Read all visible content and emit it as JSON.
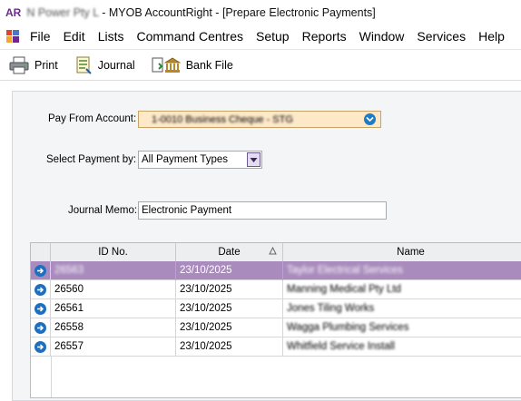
{
  "window": {
    "app_logo": "AR",
    "title_prefix": "N Power Pty L",
    "title": " - MYOB AccountRight - [Prepare Electronic Payments]"
  },
  "menu": {
    "items": [
      "File",
      "Edit",
      "Lists",
      "Command Centres",
      "Setup",
      "Reports",
      "Window",
      "Services",
      "Help"
    ]
  },
  "toolbar": {
    "print_label": "Print",
    "journal_label": "Journal",
    "bank_file_label": "Bank File"
  },
  "form": {
    "pay_from_label": "Pay From Account:",
    "pay_from_value": "1-0010 Business Cheque - STG",
    "select_payment_label": "Select Payment by:",
    "select_payment_value": "All Payment Types",
    "journal_memo_label": "Journal Memo:",
    "journal_memo_value": "Electronic Payment"
  },
  "table": {
    "columns": [
      "ID No.",
      "Date",
      "Name"
    ],
    "sorted_column": "Date",
    "rows": [
      {
        "id": "26563",
        "date": "23/10/2025",
        "name": "Taylor Electrical Services",
        "selected": true
      },
      {
        "id": "26560",
        "date": "23/10/2025",
        "name": "Manning Medical Pty Ltd",
        "selected": false
      },
      {
        "id": "26561",
        "date": "23/10/2025",
        "name": "Jones Tiling Works",
        "selected": false
      },
      {
        "id": "26558",
        "date": "23/10/2025",
        "name": "Wagga Plumbing Services",
        "selected": false
      },
      {
        "id": "26557",
        "date": "23/10/2025",
        "name": "Whitfield Service Install",
        "selected": false
      }
    ]
  },
  "colors": {
    "selected_row": "#a98bbd",
    "account_field_bg": "#fde8c8",
    "icon_blue": "#1f6fc1"
  }
}
